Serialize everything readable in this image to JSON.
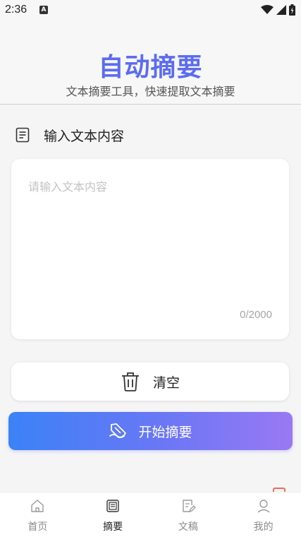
{
  "status": {
    "time": "2:36",
    "notif_letter": "A"
  },
  "header": {
    "title": "自动摘要",
    "subtitle": "文本摘要工具，快速提取文本摘要",
    "title_color": "#5b6cf0"
  },
  "input_section": {
    "title": "输入文本内容",
    "icon": "document-icon",
    "placeholder": "请输入文本内容",
    "value": "",
    "char_count": "0/2000"
  },
  "actions": {
    "clear_label": "清空",
    "clear_icon": "trash-icon",
    "start_label": "开始摘要",
    "start_icon": "summary-icon",
    "start_gradient": [
      "#3b82f6",
      "#9a78f3"
    ]
  },
  "tabs": [
    {
      "label": "首页",
      "icon": "home-icon",
      "active": false
    },
    {
      "label": "摘要",
      "icon": "summary-tab-icon",
      "active": true
    },
    {
      "label": "文稿",
      "icon": "draft-icon",
      "active": false
    },
    {
      "label": "我的",
      "icon": "profile-icon",
      "active": false
    }
  ]
}
